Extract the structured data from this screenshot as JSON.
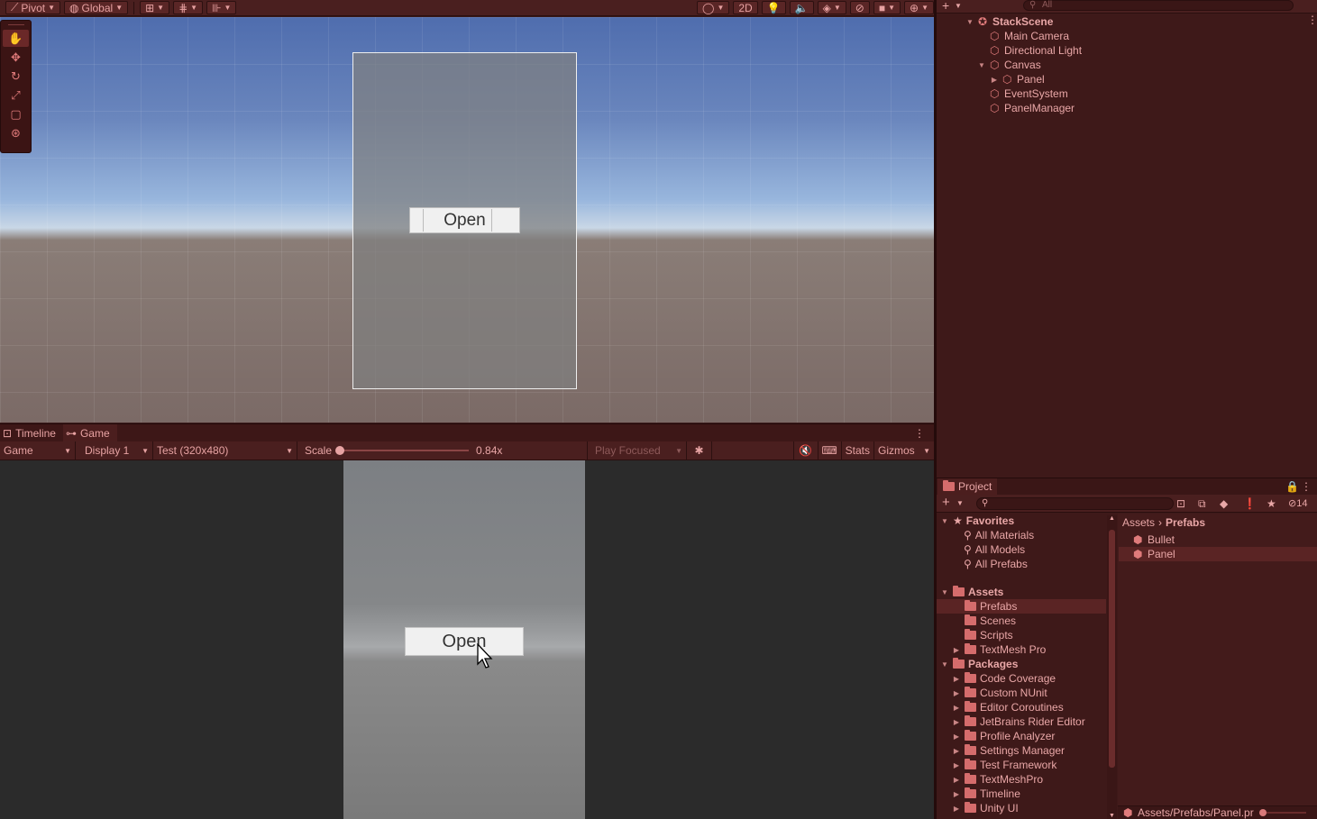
{
  "scene_toolbar": {
    "pivot": "Pivot",
    "global": "Global",
    "mode_2d": "2D"
  },
  "scene": {
    "open_button": "Open"
  },
  "bottom_tabs": [
    {
      "label": "Timeline"
    },
    {
      "label": "Game"
    }
  ],
  "game_toolbar": {
    "view": "Game",
    "display": "Display 1",
    "resolution": "Test (320x480)",
    "scale_label": "Scale",
    "scale_value": "0.84x",
    "play_mode": "Play Focused",
    "stats": "Stats",
    "gizmos": "Gizmos"
  },
  "game": {
    "open_button": "Open"
  },
  "hierarchy": {
    "search_placeholder": "All",
    "scene": "StackScene",
    "items": [
      {
        "label": "Main Camera"
      },
      {
        "label": "Directional Light"
      },
      {
        "label": "Canvas"
      },
      {
        "label": "Panel"
      },
      {
        "label": "EventSystem"
      },
      {
        "label": "PanelManager"
      }
    ]
  },
  "project": {
    "tab": "Project",
    "hidden_count": "14",
    "favorites": {
      "label": "Favorites",
      "items": [
        "All Materials",
        "All Models",
        "All Prefabs"
      ]
    },
    "assets": {
      "label": "Assets",
      "items": [
        "Prefabs",
        "Scenes",
        "Scripts",
        "TextMesh Pro"
      ]
    },
    "packages": {
      "label": "Packages",
      "items": [
        "Code Coverage",
        "Custom NUnit",
        "Editor Coroutines",
        "JetBrains Rider Editor",
        "Profile Analyzer",
        "Settings Manager",
        "Test Framework",
        "TextMeshPro",
        "Timeline",
        "Unity UI"
      ]
    },
    "breadcrumb": [
      "Assets",
      "Prefabs"
    ],
    "files": [
      "Bullet",
      "Panel"
    ],
    "footer_path": "Assets/Prefabs/Panel.pr"
  }
}
